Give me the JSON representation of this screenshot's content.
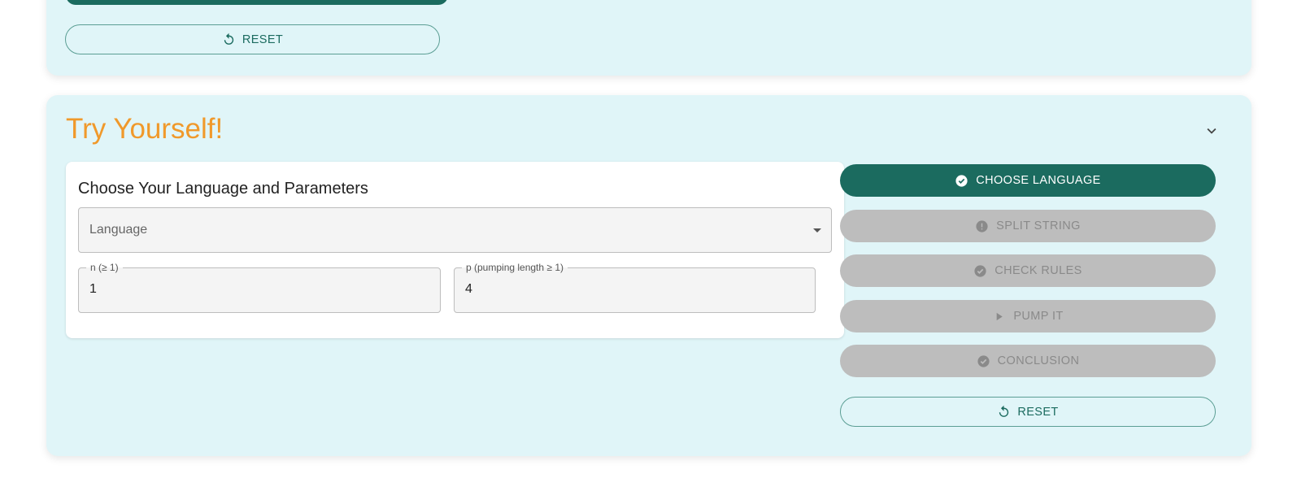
{
  "top_section": {
    "reset_label": "RESET"
  },
  "try_section": {
    "title": "Try Yourself!",
    "panel": {
      "heading": "Choose Your Language and Parameters",
      "language_placeholder": "Language",
      "n_label": "n (≥ 1)",
      "n_value": "1",
      "p_label": "p (pumping length ≥ 1)",
      "p_value": "4"
    },
    "steps": [
      {
        "label": "CHOOSE LANGUAGE",
        "icon": "check-circle-icon",
        "state": "active"
      },
      {
        "label": "SPLIT STRING",
        "icon": "exclamation-circle-icon",
        "state": "disabled"
      },
      {
        "label": "CHECK RULES",
        "icon": "check-circle-icon",
        "state": "disabled"
      },
      {
        "label": "PUMP IT",
        "icon": "play-icon",
        "state": "disabled"
      },
      {
        "label": "CONCLUSION",
        "icon": "check-circle-icon",
        "state": "disabled"
      }
    ],
    "reset_label": "RESET"
  },
  "colors": {
    "accent": "#1b6b5f",
    "title": "#f0992b",
    "card_bg": "#e0f5f8",
    "disabled": "#bdbdbd"
  }
}
